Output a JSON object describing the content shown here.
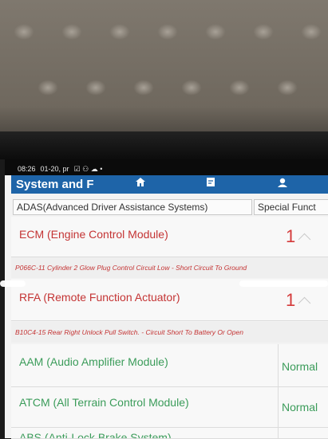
{
  "status_bar": {
    "time": "08:26",
    "date": "01-20, pr"
  },
  "header": {
    "title": "System and F",
    "home_icon": "home-icon",
    "report_icon": "report-icon",
    "user_icon": "user-icon",
    "accent": "#1e64a8"
  },
  "tabs": [
    {
      "label": "ADAS(Advanced Driver Assistance Systems)"
    },
    {
      "label": "Special Funct"
    }
  ],
  "modules": [
    {
      "name": "ECM (Engine Control Module)",
      "count": "1",
      "dtc": "P066C-11 Cylinder 2 Glow Plug Control Circuit Low - Short Circuit To Ground"
    },
    {
      "name": "RFA (Remote Function Actuator)",
      "count": "1",
      "dtc": "B10C4-15 Rear Right Unlock Pull Switch. - Circuit Short To Battery Or Open"
    },
    {
      "name": "AAM (Audio Amplifier Module)",
      "status": "Normal"
    },
    {
      "name": "ATCM (All Terrain Control Module)",
      "status": "Normal"
    },
    {
      "name": "ABS (Anti-Lock Brake System)"
    }
  ],
  "colors": {
    "fault_red": "#d43a3a",
    "normal_green": "#3b9c5a"
  }
}
